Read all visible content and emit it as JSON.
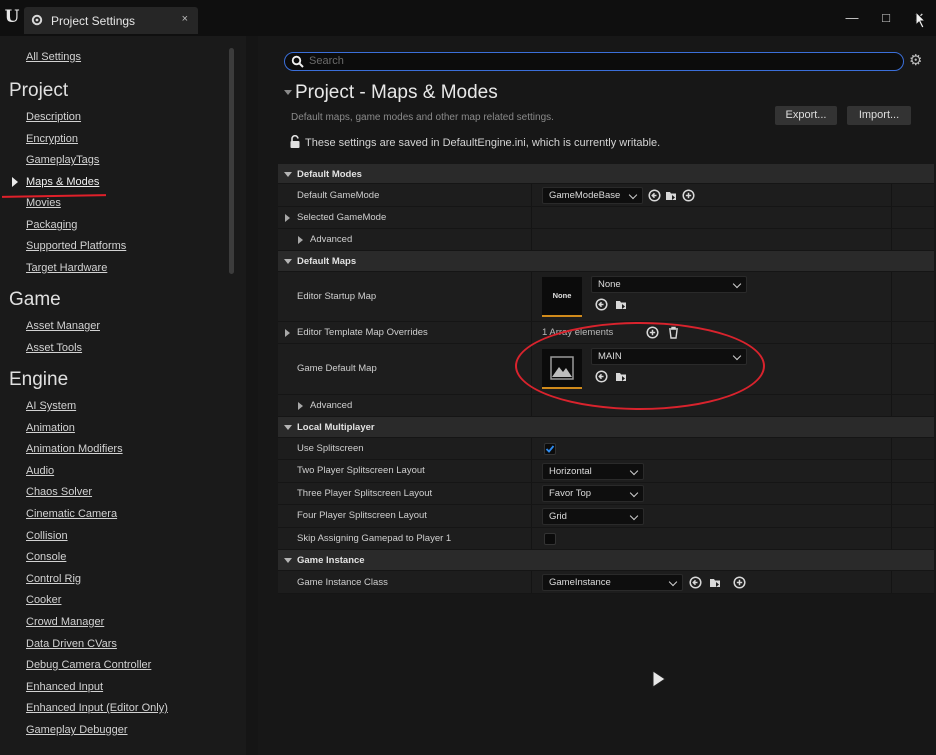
{
  "titlebar": {
    "tab_title": "Project Settings",
    "tab_close": "×",
    "minimize": "—",
    "maximize": "□",
    "close": "✕"
  },
  "sidebar": {
    "all_settings": "All Settings",
    "project_heading": "Project",
    "project_items": [
      "Description",
      "Encryption",
      "GameplayTags",
      "Maps & Modes",
      "Movies",
      "Packaging",
      "Supported Platforms",
      "Target Hardware"
    ],
    "active_item": "Maps & Modes",
    "game_heading": "Game",
    "game_items": [
      "Asset Manager",
      "Asset Tools"
    ],
    "engine_heading": "Engine",
    "engine_items": [
      "AI System",
      "Animation",
      "Animation Modifiers",
      "Audio",
      "Chaos Solver",
      "Cinematic Camera",
      "Collision",
      "Console",
      "Control Rig",
      "Cooker",
      "Crowd Manager",
      "Data Driven CVars",
      "Debug Camera Controller",
      "Enhanced Input",
      "Enhanced Input (Editor Only)",
      "Gameplay Debugger"
    ]
  },
  "main": {
    "search_placeholder": "Search",
    "title": "Project - Maps & Modes",
    "subtitle": "Default maps, game modes and other map related settings.",
    "export_label": "Export...",
    "import_label": "Import...",
    "writable_note": "These settings are saved in DefaultEngine.ini, which is currently writable."
  },
  "grid": {
    "default_modes": {
      "header": "Default Modes",
      "default_gamemode_label": "Default GameMode",
      "default_gamemode_value": "GameModeBase",
      "selected_gamemode_label": "Selected GameMode",
      "advanced_label": "Advanced"
    },
    "default_maps": {
      "header": "Default Maps",
      "editor_startup_label": "Editor Startup Map",
      "editor_startup_thumb": "None",
      "editor_startup_value": "None",
      "template_overrides_label": "Editor Template Map Overrides",
      "template_overrides_value": "1 Array elements",
      "game_default_label": "Game Default Map",
      "game_default_value": "MAIN",
      "advanced_label": "Advanced"
    },
    "local_multiplayer": {
      "header": "Local Multiplayer",
      "use_splitscreen_label": "Use Splitscreen",
      "use_splitscreen_checked": true,
      "two_player_label": "Two Player Splitscreen Layout",
      "two_player_value": "Horizontal",
      "three_player_label": "Three Player Splitscreen Layout",
      "three_player_value": "Favor Top",
      "four_player_label": "Four Player Splitscreen Layout",
      "four_player_value": "Grid",
      "skip_gamepad_label": "Skip Assigning Gamepad to Player 1",
      "skip_gamepad_checked": false
    },
    "game_instance": {
      "header": "Game Instance",
      "class_label": "Game Instance Class",
      "class_value": "GameInstance"
    }
  },
  "colors": {
    "annotation_red": "#d9232d",
    "search_border": "#3b6fd9",
    "thumb_accent": "#d08a1b"
  }
}
